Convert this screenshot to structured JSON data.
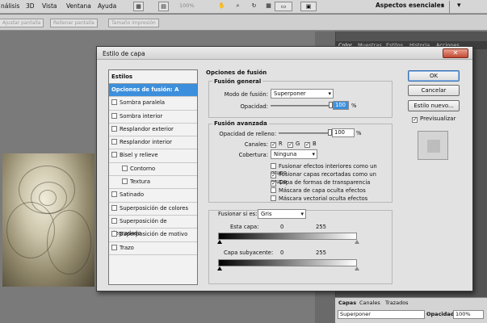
{
  "menubar": {
    "items": [
      "nálisis",
      "3D",
      "Vista",
      "Ventana",
      "Ayuda"
    ],
    "zoom": "100%",
    "workspace": "Aspectos esenciales"
  },
  "options_bar": {
    "buttons": [
      "Ajustar pantalla",
      "Rellenar pantalla",
      "Tamaño impresión"
    ]
  },
  "panels": {
    "tabs": [
      "Color",
      "Muestras",
      "Estilos",
      "Historia",
      "Acciones"
    ],
    "layers_tabs": [
      "Capas",
      "Canales",
      "Trazados"
    ],
    "blend_mode": "Superponer",
    "opacity_label": "Opacidad:",
    "opacity_value": "100%"
  },
  "dialog": {
    "title": "Estilo de capa",
    "styles_header": "Estilos",
    "style_items": [
      {
        "label": "Opciones de fusión: A medida",
        "checkbox": false,
        "selected": true,
        "indent": false
      },
      {
        "label": "Sombra paralela",
        "checkbox": true,
        "selected": false,
        "indent": false
      },
      {
        "label": "Sombra interior",
        "checkbox": true,
        "selected": false,
        "indent": false
      },
      {
        "label": "Resplandor exterior",
        "checkbox": true,
        "selected": false,
        "indent": false
      },
      {
        "label": "Resplandor interior",
        "checkbox": true,
        "selected": false,
        "indent": false
      },
      {
        "label": "Bisel y relieve",
        "checkbox": true,
        "selected": false,
        "indent": false
      },
      {
        "label": "Contorno",
        "checkbox": true,
        "selected": false,
        "indent": true
      },
      {
        "label": "Textura",
        "checkbox": true,
        "selected": false,
        "indent": true
      },
      {
        "label": "Satinado",
        "checkbox": true,
        "selected": false,
        "indent": false
      },
      {
        "label": "Superposición de colores",
        "checkbox": true,
        "selected": false,
        "indent": false
      },
      {
        "label": "Superposición de degradado",
        "checkbox": true,
        "selected": false,
        "indent": false
      },
      {
        "label": "Superposición de motivo",
        "checkbox": true,
        "selected": false,
        "indent": false
      },
      {
        "label": "Trazo",
        "checkbox": true,
        "selected": false,
        "indent": false
      }
    ],
    "blending_title": "Opciones de fusión",
    "general": {
      "title": "Fusión general",
      "mode_label": "Modo de fusión:",
      "mode_value": "Superponer",
      "opacity_label": "Opacidad:",
      "opacity_value": "100",
      "opacity_percent": 1.0,
      "unit": "%"
    },
    "advanced": {
      "title": "Fusión avanzada",
      "fill_label": "Opacidad de relleno:",
      "fill_value": "100",
      "fill_percent": 1.0,
      "unit": "%",
      "channels_label": "Canales:",
      "channels": [
        "R",
        "G",
        "B"
      ],
      "knockout_label": "Cobertura:",
      "knockout_value": "Ninguna",
      "options": [
        {
          "label": "Fusionar efectos interiores como un grupo",
          "checked": false
        },
        {
          "label": "Fusionar capas recortadas como un grupo",
          "checked": true
        },
        {
          "label": "Capa de formas de transparencia",
          "checked": true
        },
        {
          "label": "Máscara de capa oculta efectos",
          "checked": false
        },
        {
          "label": "Máscara vectorial oculta efectos",
          "checked": false
        }
      ]
    },
    "blend_if": {
      "label": "Fusionar si es:",
      "value": "Gris",
      "this_layer_label": "Esta capa:",
      "this_min": "0",
      "this_max": "255",
      "underlying_label": "Capa subyacente:",
      "under_min": "0",
      "under_max": "255"
    },
    "buttons": {
      "ok": "OK",
      "cancel": "Cancelar",
      "new_style": "Estilo nuevo...",
      "preview": "Previsualizar"
    }
  }
}
